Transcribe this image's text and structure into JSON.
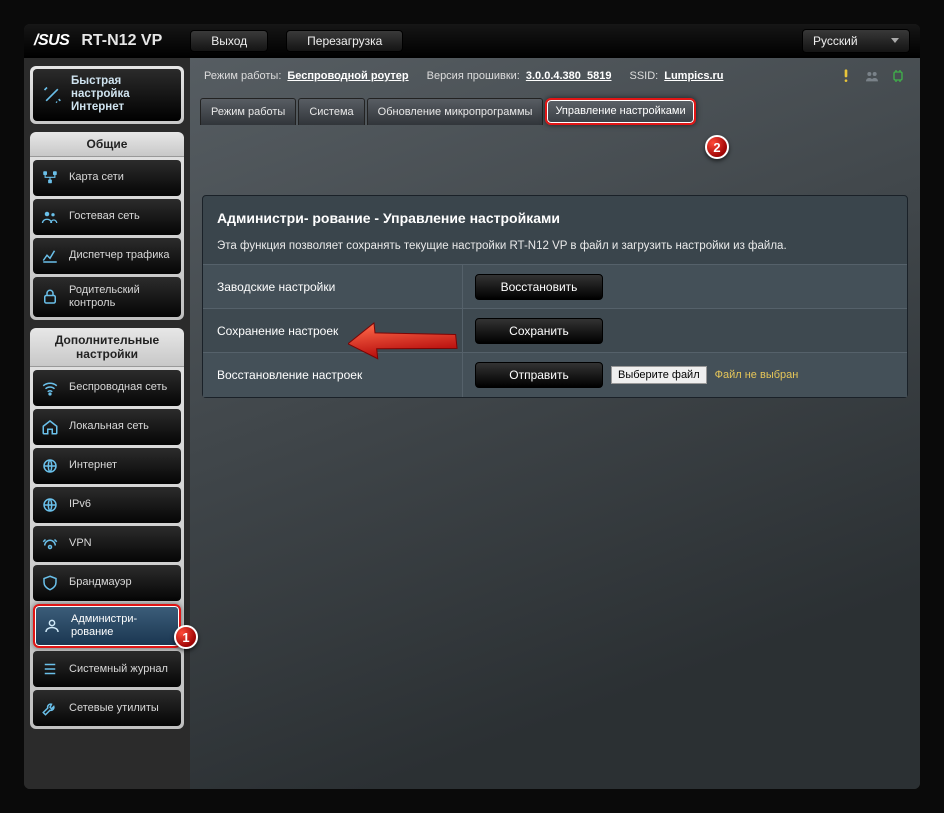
{
  "header": {
    "brand": "/SUS",
    "model": "RT-N12 VP",
    "logout": "Выход",
    "reboot": "Перезагрузка",
    "lang": "Русский"
  },
  "status": {
    "mode_label": "Режим работы:",
    "mode_value": "Беспроводной роутер",
    "fw_label": "Версия прошивки:",
    "fw_value": "3.0.0.4.380_5819",
    "ssid_label": "SSID:",
    "ssid_value": "Lumpics.ru"
  },
  "sidebar": {
    "quick": "Быстрая настройка Интернет",
    "general_title": "Общие",
    "general": {
      "map": "Карта сети",
      "guest": "Гостевая сеть",
      "traffic": "Диспетчер трафика",
      "parental": "Родительский контроль"
    },
    "advanced_title": "Дополнительные настройки",
    "advanced": {
      "wireless": "Беспроводная сеть",
      "lan": "Локальная сеть",
      "wan": "Интернет",
      "ipv6": "IPv6",
      "vpn": "VPN",
      "firewall": "Брандмауэр",
      "admin": "Администри- рование",
      "syslog": "Системный журнал",
      "nettools": "Сетевые утилиты"
    }
  },
  "tabs": {
    "mode": "Режим работы",
    "system": "Система",
    "firmware": "Обновление микропрограммы",
    "settings": "Управление настройками"
  },
  "panel": {
    "title": "Администри- рование - Управление настройками",
    "desc": "Эта функция позволяет сохранять текущие настройки RT-N12 VP в файл и загрузить настройки из файла.",
    "factory_label": "Заводские настройки",
    "factory_btn": "Восстановить",
    "save_label": "Сохранение настроек",
    "save_btn": "Сохранить",
    "restore_label": "Восстановление настроек",
    "restore_btn": "Отправить",
    "file_btn": "Выберите файл",
    "file_none": "Файл не выбран"
  },
  "badges": {
    "one": "1",
    "two": "2"
  }
}
